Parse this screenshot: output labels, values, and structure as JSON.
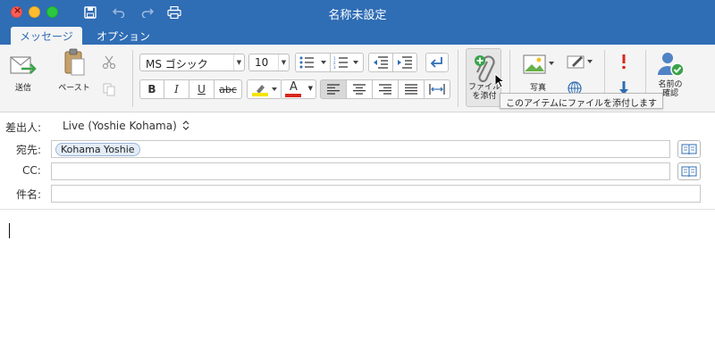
{
  "window": {
    "title": "名称未設定"
  },
  "tabs": [
    {
      "label": "メッセージ",
      "active": true
    },
    {
      "label": "オプション",
      "active": false
    }
  ],
  "ribbon": {
    "send_label": "送信",
    "paste_label": "ペースト",
    "font_name": "MS ゴシック",
    "font_size": "10",
    "bold": "B",
    "italic": "I",
    "underline": "U",
    "strikethrough": "abc",
    "font_color_letter": "A",
    "attach_label_line1": "ファイル",
    "attach_label_line2": "を添付",
    "photo_label": "写真",
    "check_names_line1": "名前の",
    "check_names_line2": "確認",
    "tooltip": "このアイテムにファイルを添付します",
    "highlight_color": "#f5e400",
    "font_color": "#d9261c"
  },
  "header": {
    "from_label": "差出人:",
    "from_value": "Live (Yoshie Kohama)",
    "to_label": "宛先:",
    "to_recipient": "Kohama Yoshie",
    "cc_label": "CC:",
    "cc_value": "",
    "subject_label": "件名:",
    "subject_value": ""
  },
  "colors": {
    "accent": "#2f6db5",
    "ribbon_bg": "#f4f4f4"
  }
}
